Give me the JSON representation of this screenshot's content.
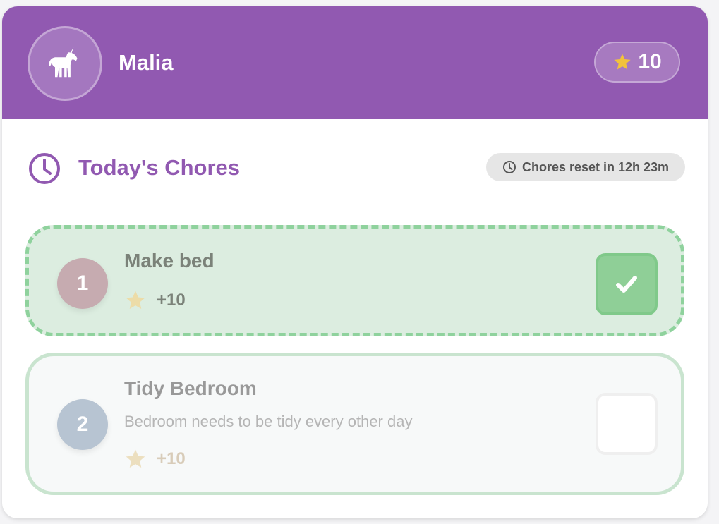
{
  "profile": {
    "name": "Malia",
    "avatar_icon": "unicorn-icon",
    "points": "10",
    "points_icon": "star-icon",
    "header_color": "#9159b1"
  },
  "section": {
    "icon": "clock-icon",
    "title": "Today's Chores",
    "reset_label": "Chores reset in 12h 23m"
  },
  "chores": [
    {
      "number": "1",
      "title": "Make bed",
      "description": "",
      "reward": "+10",
      "completed": true
    },
    {
      "number": "2",
      "title": "Tidy Bedroom",
      "description": "Bedroom needs to be tidy every other day",
      "reward": "+10",
      "completed": false
    }
  ],
  "colors": {
    "accent": "#9159b1",
    "done_bg": "#dcede0",
    "done_border": "#8fd29d",
    "star": "#f2c23c"
  }
}
